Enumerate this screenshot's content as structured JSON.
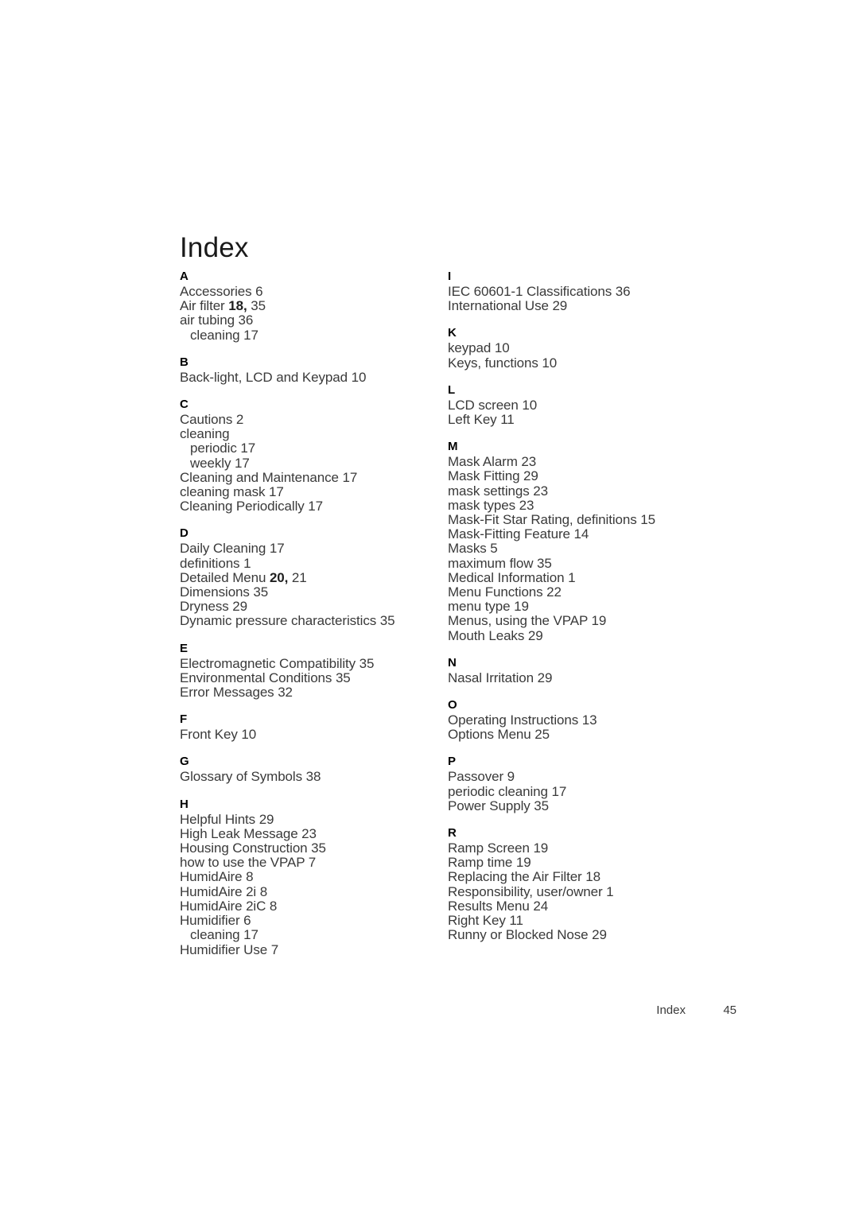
{
  "document": {
    "title": "Index"
  },
  "footer": {
    "label": "Index",
    "page_number": "45"
  },
  "columns": [
    {
      "id": "left",
      "groups": [
        {
          "letter": "A",
          "entries": [
            {
              "text": "Accessories 6",
              "level": 0
            },
            {
              "text": "Air filter ",
              "level": 0,
              "primary": "18,",
              "tail": " 35"
            },
            {
              "text": "air tubing 36",
              "level": 0
            },
            {
              "text": "cleaning 17",
              "level": 1
            }
          ]
        },
        {
          "letter": "B",
          "entries": [
            {
              "text": "Back-light, LCD and Keypad 10",
              "level": 0
            }
          ]
        },
        {
          "letter": "C",
          "entries": [
            {
              "text": "Cautions 2",
              "level": 0
            },
            {
              "text": "cleaning",
              "level": 0
            },
            {
              "text": "periodic 17",
              "level": 1
            },
            {
              "text": "weekly 17",
              "level": 1
            },
            {
              "text": "Cleaning and Maintenance 17",
              "level": 0
            },
            {
              "text": "cleaning mask 17",
              "level": 0
            },
            {
              "text": "Cleaning Periodically 17",
              "level": 0
            }
          ]
        },
        {
          "letter": "D",
          "entries": [
            {
              "text": "Daily Cleaning 17",
              "level": 0
            },
            {
              "text": "definitions 1",
              "level": 0
            },
            {
              "text": "Detailed Menu ",
              "level": 0,
              "primary": "20,",
              "tail": " 21"
            },
            {
              "text": "Dimensions 35",
              "level": 0
            },
            {
              "text": "Dryness 29",
              "level": 0
            },
            {
              "text": "Dynamic pressure characteristics 35",
              "level": 0
            }
          ]
        },
        {
          "letter": "E",
          "entries": [
            {
              "text": "Electromagnetic Compatibility 35",
              "level": 0
            },
            {
              "text": "Environmental Conditions 35",
              "level": 0
            },
            {
              "text": "Error Messages 32",
              "level": 0
            }
          ]
        },
        {
          "letter": "F",
          "entries": [
            {
              "text": "Front Key 10",
              "level": 0
            }
          ]
        },
        {
          "letter": "G",
          "entries": [
            {
              "text": "Glossary of Symbols 38",
              "level": 0
            }
          ]
        },
        {
          "letter": "H",
          "entries": [
            {
              "text": "Helpful Hints 29",
              "level": 0
            },
            {
              "text": "High Leak Message 23",
              "level": 0
            },
            {
              "text": "Housing Construction 35",
              "level": 0
            },
            {
              "text": "how to use the VPAP 7",
              "level": 0
            },
            {
              "text": "HumidAire 8",
              "level": 0
            },
            {
              "text": "HumidAire 2i 8",
              "level": 0
            },
            {
              "text": "HumidAire 2iC 8",
              "level": 0
            },
            {
              "text": "Humidifier 6",
              "level": 0
            },
            {
              "text": "cleaning 17",
              "level": 1
            },
            {
              "text": "Humidifier Use 7",
              "level": 0
            }
          ]
        }
      ]
    },
    {
      "id": "right",
      "groups": [
        {
          "letter": "I",
          "entries": [
            {
              "text": "IEC 60601-1 Classifications 36",
              "level": 0
            },
            {
              "text": "International Use 29",
              "level": 0
            }
          ]
        },
        {
          "letter": "K",
          "entries": [
            {
              "text": "keypad 10",
              "level": 0
            },
            {
              "text": "Keys, functions 10",
              "level": 0
            }
          ]
        },
        {
          "letter": "L",
          "entries": [
            {
              "text": "LCD screen 10",
              "level": 0
            },
            {
              "text": "Left Key 11",
              "level": 0
            }
          ]
        },
        {
          "letter": "M",
          "entries": [
            {
              "text": "Mask Alarm 23",
              "level": 0
            },
            {
              "text": "Mask Fitting 29",
              "level": 0
            },
            {
              "text": "mask settings 23",
              "level": 0
            },
            {
              "text": "mask types 23",
              "level": 0
            },
            {
              "text": "Mask-Fit Star Rating, definitions 15",
              "level": 0
            },
            {
              "text": "Mask-Fitting Feature 14",
              "level": 0
            },
            {
              "text": "Masks 5",
              "level": 0
            },
            {
              "text": "maximum flow 35",
              "level": 0
            },
            {
              "text": "Medical Information 1",
              "level": 0
            },
            {
              "text": "Menu Functions 22",
              "level": 0
            },
            {
              "text": "menu type 19",
              "level": 0
            },
            {
              "text": "Menus, using the VPAP 19",
              "level": 0
            },
            {
              "text": "Mouth Leaks 29",
              "level": 0
            }
          ]
        },
        {
          "letter": "N",
          "entries": [
            {
              "text": "Nasal Irritation 29",
              "level": 0
            }
          ]
        },
        {
          "letter": "O",
          "entries": [
            {
              "text": "Operating Instructions 13",
              "level": 0
            },
            {
              "text": "Options Menu 25",
              "level": 0
            }
          ]
        },
        {
          "letter": "P",
          "entries": [
            {
              "text": "Passover 9",
              "level": 0
            },
            {
              "text": "periodic cleaning 17",
              "level": 0
            },
            {
              "text": "Power Supply 35",
              "level": 0
            }
          ]
        },
        {
          "letter": "R",
          "entries": [
            {
              "text": "Ramp Screen 19",
              "level": 0
            },
            {
              "text": "Ramp time 19",
              "level": 0
            },
            {
              "text": "Replacing the Air Filter 18",
              "level": 0
            },
            {
              "text": "Responsibility, user/owner 1",
              "level": 0
            },
            {
              "text": "Results Menu 24",
              "level": 0
            },
            {
              "text": "Right Key 11",
              "level": 0
            },
            {
              "text": "Runny or Blocked Nose 29",
              "level": 0
            }
          ]
        }
      ]
    }
  ]
}
